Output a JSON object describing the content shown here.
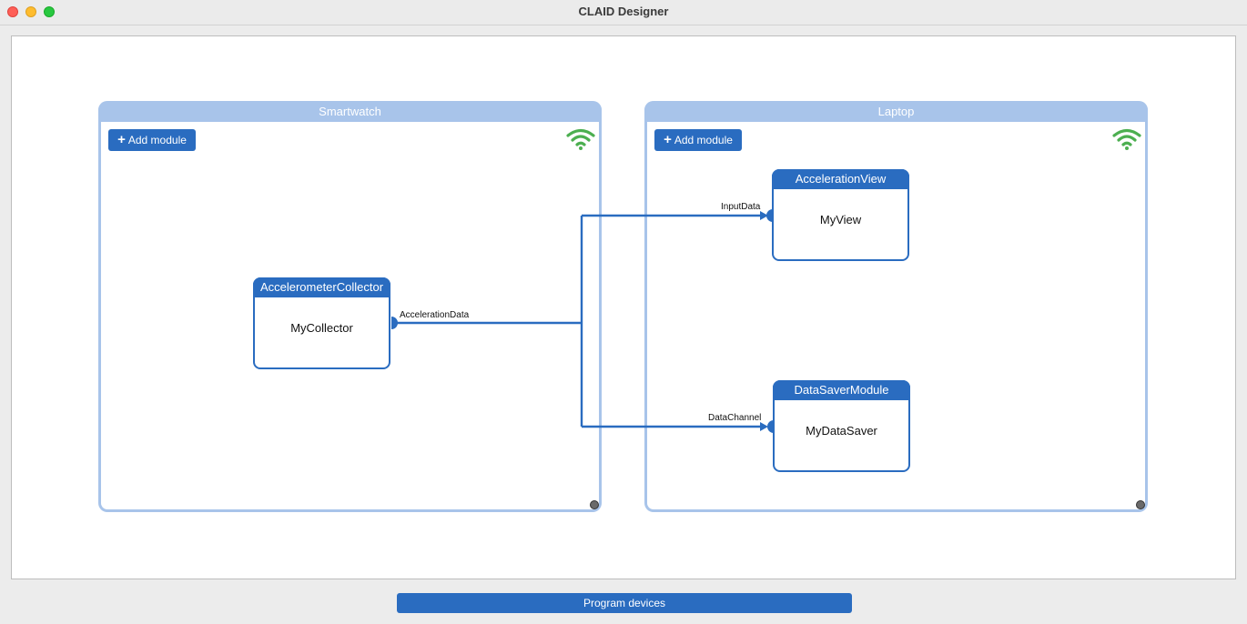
{
  "window": {
    "title": "CLAID Designer"
  },
  "devices": {
    "smartwatch": {
      "title": "Smartwatch",
      "add_label": "Add module",
      "status_icon": "wifi-icon",
      "status_color": "#4caf50"
    },
    "laptop": {
      "title": "Laptop",
      "add_label": "Add module",
      "status_icon": "wifi-icon",
      "status_color": "#4caf50"
    }
  },
  "modules": {
    "accelerometer_collector": {
      "type": "AccelerometerCollector",
      "name": "MyCollector"
    },
    "acceleration_view": {
      "type": "AccelerationView",
      "name": "MyView"
    },
    "data_saver": {
      "type": "DataSaverModule",
      "name": "MyDataSaver"
    }
  },
  "connections": {
    "output_label": "AccelerationData",
    "input_view_label": "InputData",
    "input_saver_label": "DataChannel"
  },
  "footer": {
    "program_label": "Program devices"
  },
  "colors": {
    "accent": "#2a6cc0",
    "device_frame": "#a8c4ea",
    "connection": "#2a6cc0"
  }
}
